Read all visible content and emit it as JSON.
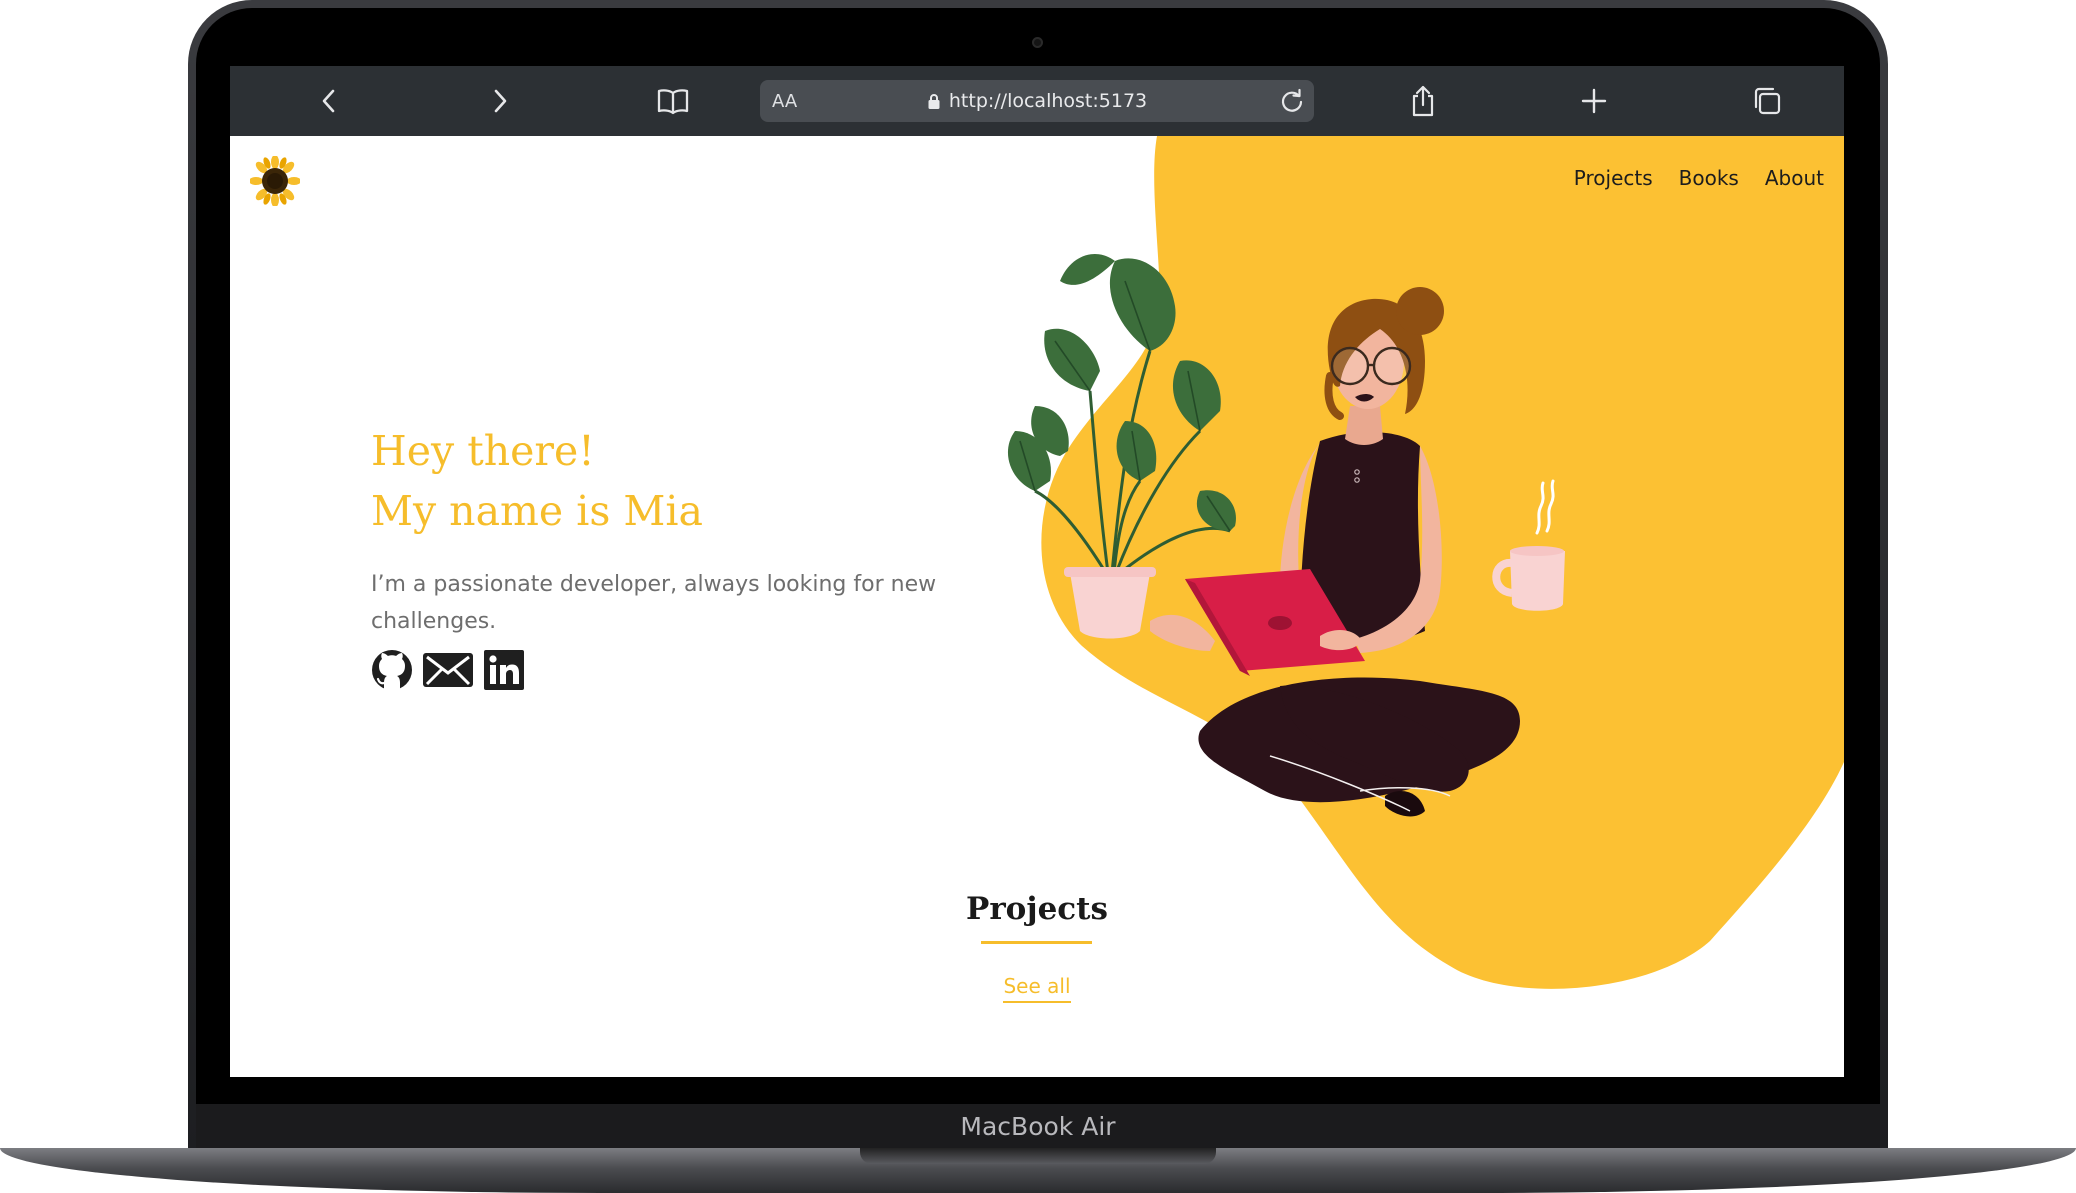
{
  "device": {
    "label": "MacBook Air"
  },
  "browser": {
    "address_text_size": "AA",
    "url": "http://localhost:5173"
  },
  "page": {
    "nav": [
      {
        "label": "Projects"
      },
      {
        "label": "Books"
      },
      {
        "label": "About"
      }
    ],
    "hero": {
      "title_line1": "Hey there!",
      "title_line2": "My name is Mia",
      "subtitle": "I’m a passionate developer, always looking for new challenges."
    },
    "socials": [
      {
        "icon": "github-icon"
      },
      {
        "icon": "mail-icon"
      },
      {
        "icon": "linkedin-icon"
      }
    ],
    "projects": {
      "heading": "Projects",
      "link": "See all"
    }
  },
  "colors": {
    "accent": "#f6bd2b",
    "toolbar": "#2c3034",
    "heading": "#1a1a1a",
    "body_text": "#6e6e6e"
  }
}
